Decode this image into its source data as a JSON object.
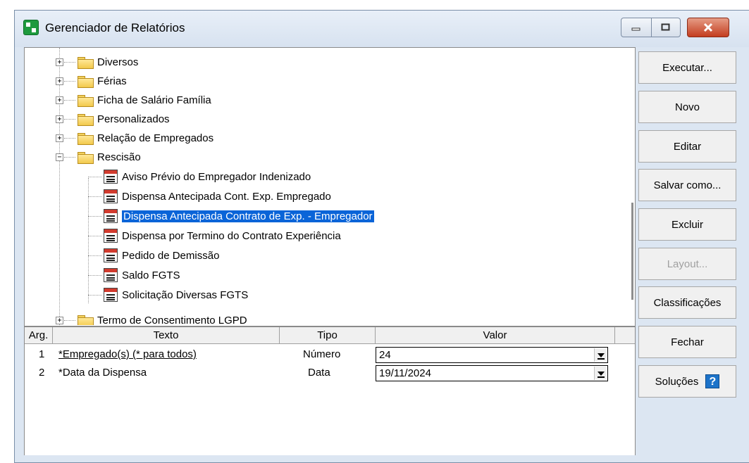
{
  "window": {
    "title": "Gerenciador de Relatórios"
  },
  "tree": {
    "items": [
      {
        "label": "Diversos",
        "type": "folder",
        "expanded": false
      },
      {
        "label": "Férias",
        "type": "folder",
        "expanded": false
      },
      {
        "label": "Ficha de Salário Família",
        "type": "folder",
        "expanded": false
      },
      {
        "label": "Personalizados",
        "type": "folder",
        "expanded": false
      },
      {
        "label": "Relação de Empregados",
        "type": "folder",
        "expanded": false
      },
      {
        "label": "Rescisão",
        "type": "folder",
        "expanded": true
      },
      {
        "label": "Aviso Prévio do Empregador Indenizado",
        "type": "report"
      },
      {
        "label": "Dispensa Antecipada Cont. Exp. Empregado",
        "type": "report"
      },
      {
        "label": "Dispensa Antecipada Contrato de Exp. - Empregador",
        "type": "report",
        "selected": true
      },
      {
        "label": "Dispensa por Termino do Contrato Experiência",
        "type": "report"
      },
      {
        "label": "Pedido de Demissão",
        "type": "report"
      },
      {
        "label": "Saldo FGTS",
        "type": "report"
      },
      {
        "label": "Solicitação Diversas FGTS",
        "type": "report"
      },
      {
        "label": "Termo de Consentimento LGPD",
        "type": "folder",
        "expanded": false
      }
    ]
  },
  "grid": {
    "headers": [
      "Arg.",
      "Texto",
      "Tipo",
      "Valor"
    ],
    "rows": [
      {
        "arg": "1",
        "texto": "*Empregado(s) (* para todos)",
        "tipo": "Número",
        "valor": "24"
      },
      {
        "arg": "2",
        "texto": "*Data da Dispensa",
        "tipo": "Data",
        "valor": "19/11/2024"
      }
    ]
  },
  "buttons": {
    "executar": "Executar...",
    "novo": "Novo",
    "editar": "Editar",
    "salvar_como": "Salvar como...",
    "excluir": "Excluir",
    "layout": "Layout...",
    "classificacoes": "Classificações",
    "fechar": "Fechar",
    "solucoes": "Soluções"
  },
  "icons": {
    "app": "app-green-icon",
    "folder": "folder-icon",
    "report": "report-icon",
    "help": "help-icon"
  },
  "colors": {
    "selection": "#0a64d8",
    "close_button": "#c33d1f",
    "window_frame": "#dce6f2"
  }
}
